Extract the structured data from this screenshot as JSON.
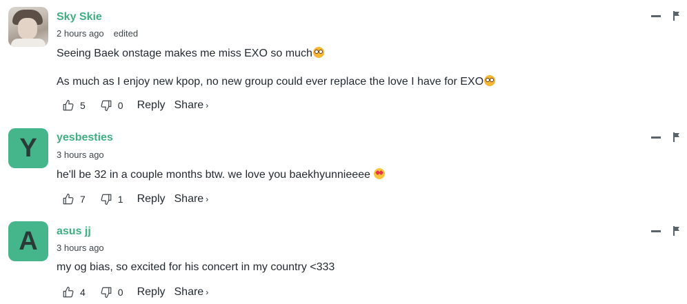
{
  "comments": [
    {
      "author": "Sky Skie",
      "time": "2 hours ago",
      "edited": "edited",
      "lines": [
        {
          "text": "Seeing Baek onstage makes me miss EXO so much",
          "emoji": "flushed-face"
        },
        {
          "text": "As much as I enjoy new kpop, no new group could ever replace the love I have for EXO",
          "emoji": "pleading-face"
        }
      ],
      "likes": "5",
      "dislikes": "0",
      "reply_label": "Reply",
      "share_label": "Share",
      "share_chevron": "›"
    },
    {
      "author": "yesbesties",
      "avatar_letter": "Y",
      "time": "3 hours ago",
      "lines": [
        {
          "text": "he'll be 32 in a couple months btw. we love you baekhyunnieeee ",
          "emoji": "heart-eyes-face"
        }
      ],
      "likes": "7",
      "dislikes": "1",
      "reply_label": "Reply",
      "share_label": "Share",
      "share_chevron": "›"
    },
    {
      "author": "asus jj",
      "avatar_letter": "A",
      "time": "3 hours ago",
      "lines": [
        {
          "text": "my og bias, so excited for his concert in my country <333"
        }
      ],
      "likes": "4",
      "dislikes": "0",
      "reply_label": "Reply",
      "share_label": "Share",
      "share_chevron": "›"
    }
  ],
  "colors": {
    "author": "#3daf80",
    "avatar_bg": "#45b58c",
    "text": "#232a31",
    "muted": "#3d4449"
  }
}
